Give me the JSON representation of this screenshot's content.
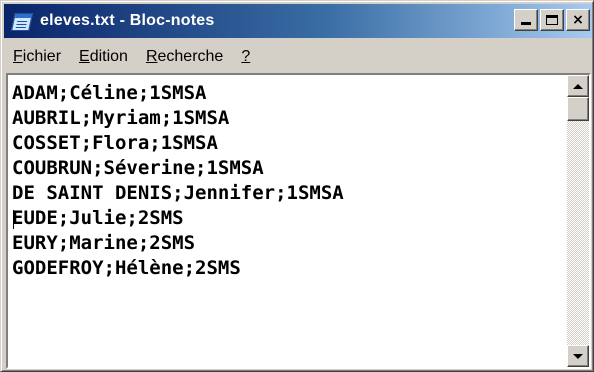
{
  "window": {
    "title": "eleves.txt - Bloc-notes"
  },
  "icons": {
    "app": "notepad-icon",
    "minimize": "minimize-icon",
    "maximize": "maximize-icon",
    "close": "close-icon",
    "close_glyph": "×",
    "scroll_up": "arrow-up-icon",
    "scroll_down": "arrow-down-icon"
  },
  "menu": [
    {
      "accel": "F",
      "rest": "ichier"
    },
    {
      "accel": "E",
      "rest": "dition"
    },
    {
      "accel": "R",
      "rest": "echerche"
    },
    {
      "accel": "?",
      "rest": ""
    }
  ],
  "editor": {
    "lines": [
      "ADAM;Céline;1SMSA",
      "AUBRIL;Myriam;1SMSA",
      "COSSET;Flora;1SMSA",
      "COUBRUN;Séverine;1SMSA",
      "DE SAINT DENIS;Jennifer;1SMSA",
      "EUDE;Julie;2SMS",
      "EURY;Marine;2SMS",
      "GODEFROY;Hélène;2SMS"
    ],
    "caret_line": 6
  },
  "colors": {
    "title_gradient_start": "#0a246a",
    "title_gradient_end": "#a6caf0",
    "chrome": "#d4d0c8",
    "editor_bg": "#ffffff",
    "text": "#000000"
  }
}
